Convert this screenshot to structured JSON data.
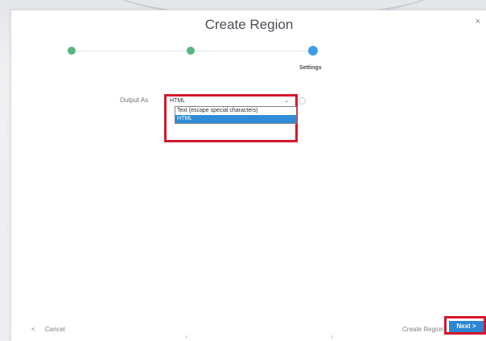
{
  "dialog": {
    "title": "Create Region",
    "close_glyph": "×"
  },
  "wizard": {
    "steps": [
      {
        "state": "complete",
        "label": ""
      },
      {
        "state": "complete",
        "label": ""
      },
      {
        "state": "active",
        "label": "Settings"
      }
    ],
    "colors": {
      "complete": "#57b580",
      "active": "#3c9ee6"
    }
  },
  "form": {
    "output_as_label": "Output As",
    "output_as_value": "HTML",
    "options": [
      {
        "label": "Text (escape special characters)",
        "selected": false
      },
      {
        "label": "HTML",
        "selected": true
      }
    ]
  },
  "footer": {
    "back_glyph": "<",
    "cancel_label": "Cancel",
    "create_region_label": "Create Region",
    "next_label": "Next",
    "next_glyph": ">"
  },
  "colors": {
    "highlight_border": "#d6162c",
    "primary": "#2a87d3"
  }
}
